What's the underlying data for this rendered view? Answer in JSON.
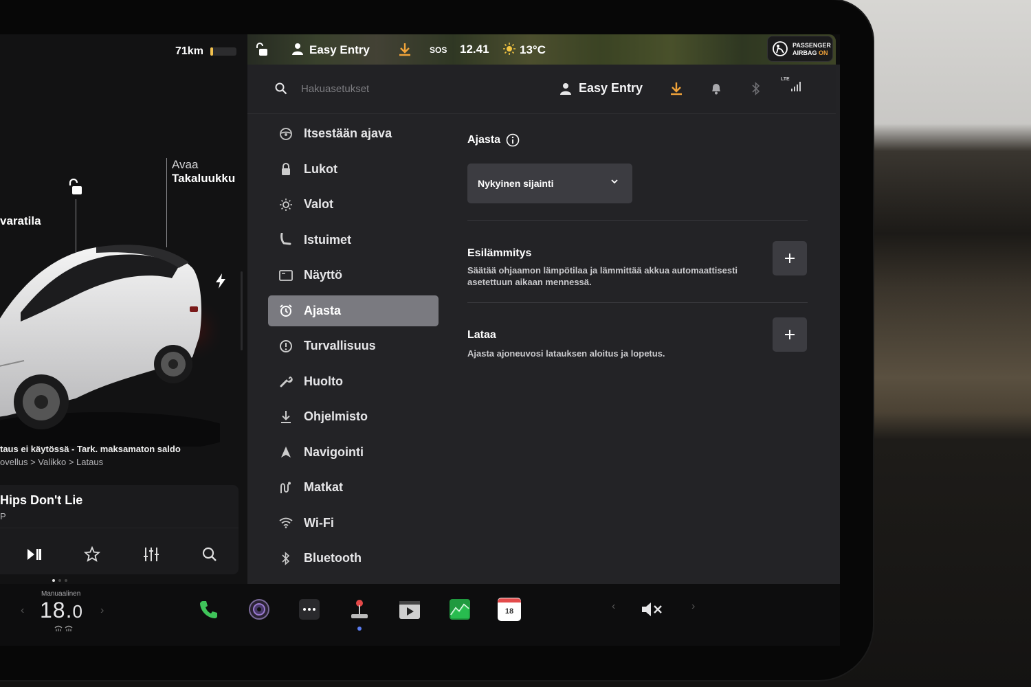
{
  "status": {
    "range": "71km",
    "battery_fraction": 0.1,
    "profile": "Easy Entry",
    "sos": "SOS",
    "time": "12.41",
    "temperature": "13°C",
    "airbag_line1": "PASSENGER",
    "airbag_line2_prefix": "AIRBAG",
    "airbag_line2_state": "ON"
  },
  "car": {
    "trunk_line1": "Avaa",
    "trunk_line2": "Takaluukku",
    "frunk_label": "varatila",
    "charge_message": "taus ei käytössä - Tark. maksamaton saldo",
    "charge_path": "ovellus > Valikko > Lataus"
  },
  "media": {
    "song": "Hips Don't Lie",
    "artist": "P"
  },
  "settings": {
    "search_placeholder": "Hakuasetukset",
    "header_profile": "Easy Entry",
    "lte_label": "LTE",
    "menu": [
      {
        "label": "Itsestään ajava",
        "icon": "steering-wheel-icon"
      },
      {
        "label": "Lukot",
        "icon": "lock-icon"
      },
      {
        "label": "Valot",
        "icon": "light-icon"
      },
      {
        "label": "Istuimet",
        "icon": "seat-icon"
      },
      {
        "label": "Näyttö",
        "icon": "display-icon"
      },
      {
        "label": "Ajasta",
        "icon": "alarm-clock-icon",
        "active": true
      },
      {
        "label": "Turvallisuus",
        "icon": "safety-icon"
      },
      {
        "label": "Huolto",
        "icon": "wrench-icon"
      },
      {
        "label": "Ohjelmisto",
        "icon": "download-icon"
      },
      {
        "label": "Navigointi",
        "icon": "navigation-icon"
      },
      {
        "label": "Matkat",
        "icon": "trips-icon"
      },
      {
        "label": "Wi-Fi",
        "icon": "wifi-icon"
      },
      {
        "label": "Bluetooth",
        "icon": "bluetooth-icon"
      }
    ],
    "content": {
      "title": "Ajasta",
      "location_selected": "Nykyinen sijainti",
      "preheat_title": "Esilämmitys",
      "preheat_desc_1": "Säätää ohjaamon lämpötilaa ja lämmittää akkua automaattisesti",
      "preheat_desc_2": "asetettuun aikaan mennessä.",
      "charge_title": "Lataa",
      "charge_desc": "Ajasta ajoneuvosi latauksen aloitus ja lopetus."
    }
  },
  "dock": {
    "climate_mode": "Manuaalinen",
    "temp_int": "18.",
    "temp_dec": "0",
    "calendar_day": "18"
  },
  "colors": {
    "accent_orange": "#f2a43a",
    "active_menu": "#7a7a80",
    "panel": "#232326"
  }
}
